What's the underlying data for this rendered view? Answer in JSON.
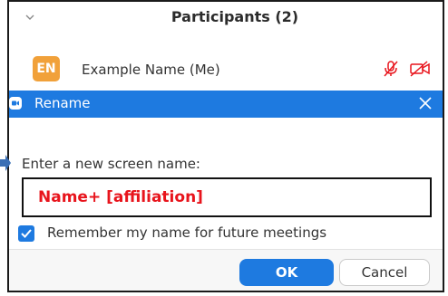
{
  "participants": {
    "title": "Participants (2)",
    "chevron_icon": "chevron-down-icon",
    "me": {
      "initials": "EN",
      "name": "Example Name (Me)",
      "avatar_color": "#f1a13a",
      "mic_icon": "mic-muted-icon",
      "video_icon": "video-off-icon",
      "status_icon_color": "#e8141c"
    }
  },
  "rename_dialog": {
    "title": "Rename",
    "close_icon": "close-icon",
    "prompt": "Enter a new screen name:",
    "input_value": "Name+ [affiliation]",
    "input_value_color": "#e8141c",
    "remember_checked": true,
    "remember_label": "Remember my name for future meetings",
    "ok_label": "OK",
    "cancel_label": "Cancel",
    "accent_color": "#1e7ae0"
  }
}
